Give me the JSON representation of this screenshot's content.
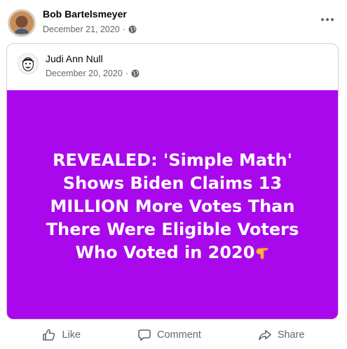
{
  "post": {
    "author": "Bob Bartelsmeyer",
    "date": "December 21, 2020",
    "separator": "·",
    "privacy_icon": "globe-icon",
    "more_icon": "more-options-icon"
  },
  "shared_post": {
    "author": "Judi Ann Null",
    "date": "December 20, 2020",
    "separator": "·",
    "privacy_icon": "globe-icon",
    "background_color": "#aa08ec",
    "headline_lines": [
      "REVEALED: 'Simple Math'",
      "Shows Biden Claims 13",
      "MILLION More Votes Than",
      "There Were Eligible Voters",
      "Who Voted in 2020"
    ],
    "headline_emoji": "backhand-index-pointing-down"
  },
  "actions": {
    "like_label": "Like",
    "comment_label": "Comment",
    "share_label": "Share"
  }
}
